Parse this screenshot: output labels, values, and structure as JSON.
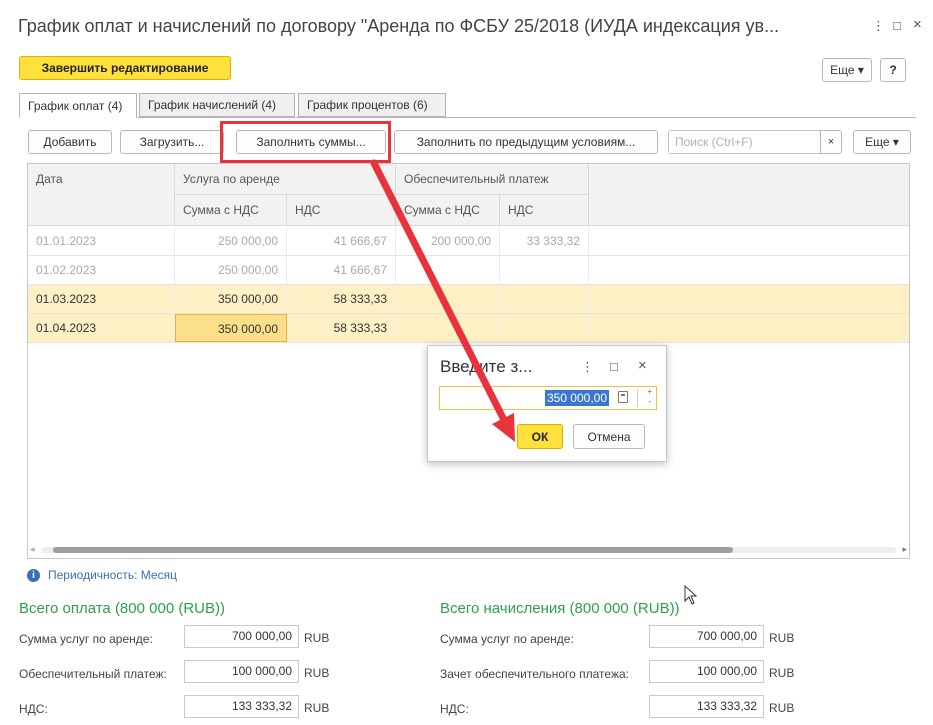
{
  "window": {
    "title": "График оплат и начислений по договору \"Аренда по ФСБУ 25/2018 (ИУДА индексация ув...",
    "more_icon": "⋮",
    "restore_icon": "□",
    "close_icon": "×"
  },
  "header_toolbar": {
    "finish_edit": "Завершить редактирование",
    "more": "Еще ▾",
    "help": "?"
  },
  "tabs": [
    {
      "label": "График оплат (4)"
    },
    {
      "label": "График начислений (4)"
    },
    {
      "label": "График процентов (6)"
    }
  ],
  "toolbar": {
    "add": "Добавить",
    "load": "Загрузить...",
    "fill_sums": "Заполнить суммы...",
    "fill_prev": "Заполнить по предыдущим условиям...",
    "search_placeholder": "Поиск (Ctrl+F)",
    "clear": "×",
    "more": "Еще ▾"
  },
  "grid": {
    "col_date": "Дата",
    "group_rent": "Услуга по аренде",
    "group_deposit": "Обеспечительный платеж",
    "sub_sum_vat": "Сумма с НДС",
    "sub_vat": "НДС",
    "rows": [
      {
        "date": "01.01.2023",
        "rent_sum": "250 000,00",
        "rent_vat": "41 666,67",
        "dep_sum": "200 000,00",
        "dep_vat": "33 333,32"
      },
      {
        "date": "01.02.2023",
        "rent_sum": "250 000,00",
        "rent_vat": "41 666,67",
        "dep_sum": "",
        "dep_vat": ""
      },
      {
        "date": "01.03.2023",
        "rent_sum": "350 000,00",
        "rent_vat": "58 333,33",
        "dep_sum": "",
        "dep_vat": ""
      },
      {
        "date": "01.04.2023",
        "rent_sum": "350 000,00",
        "rent_vat": "58 333,33",
        "dep_sum": "",
        "dep_vat": ""
      }
    ]
  },
  "periodicity": "Периодичность: Месяц",
  "totals_pay": {
    "title": "Всего оплата (800 000 (RUB))",
    "rent_label": "Сумма услуг по аренде:",
    "rent_value": "700 000,00",
    "deposit_label": "Обеспечительный платеж:",
    "deposit_value": "100 000,00",
    "vat_label": "НДС:",
    "vat_value": "133 333,32",
    "currency": "RUB"
  },
  "totals_accr": {
    "title": "Всего начисления (800 000 (RUB))",
    "rent_label": "Сумма услуг по аренде:",
    "rent_value": "700 000,00",
    "deposit_label": "Зачет обеспечительного платежа:",
    "deposit_value": "100 000,00",
    "vat_label": "НДС:",
    "vat_value": "133 333,32",
    "currency": "RUB"
  },
  "dialog": {
    "title": "Введите з...",
    "value": "350 000,00",
    "ok": "ОК",
    "cancel": "Отмена",
    "more_icon": "⋮",
    "restore_icon": "□",
    "close_icon": "×"
  },
  "colors": {
    "accent_yellow": "#ffe03d",
    "row_highlight": "#fdf0c4",
    "totals_green": "#2ea04a",
    "link_blue": "#3b6fb6",
    "annotation_red": "#e8323c"
  }
}
